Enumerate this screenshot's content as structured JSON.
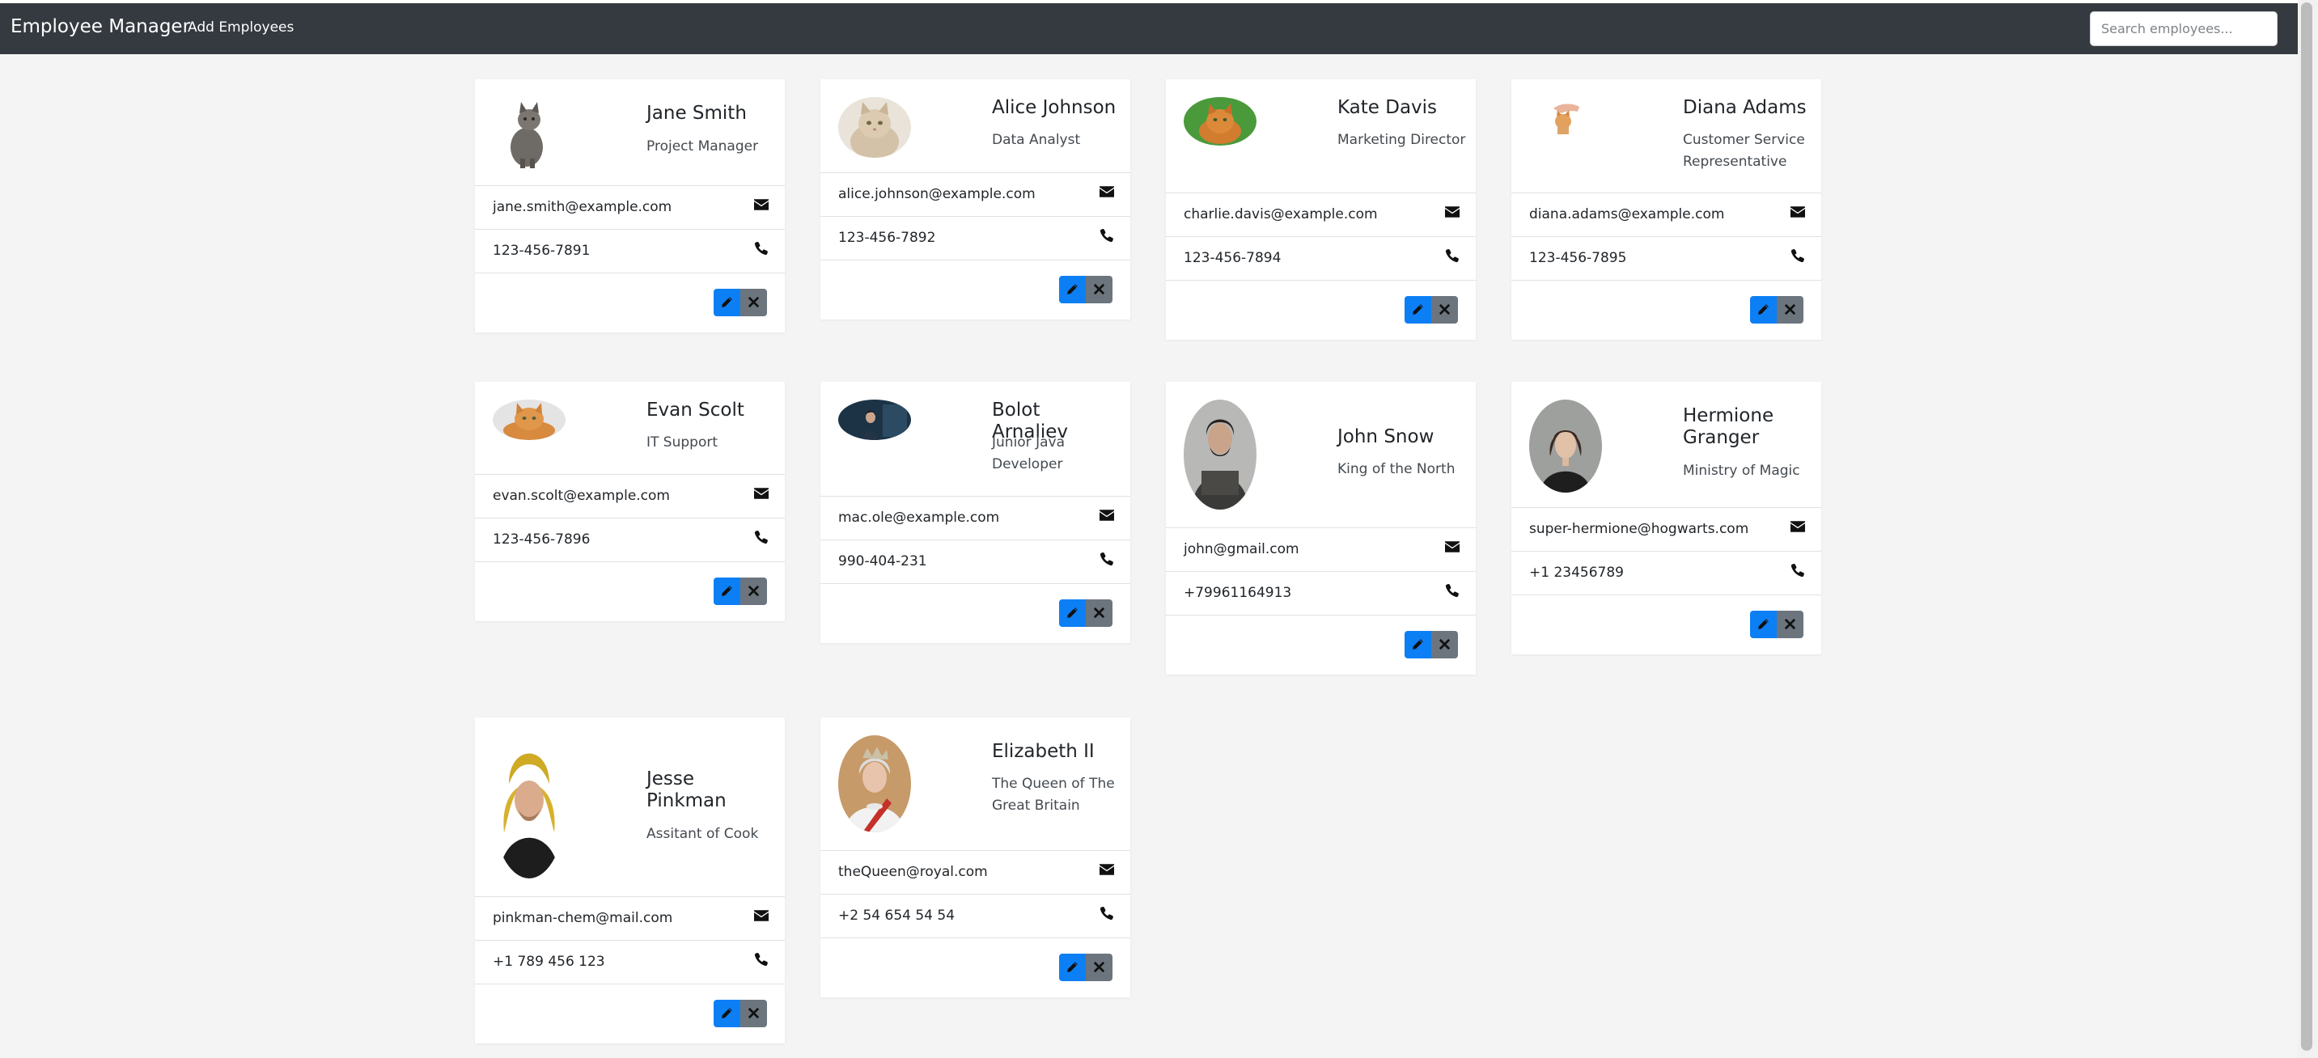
{
  "navbar": {
    "brand": "Employee Manager",
    "add_link": "Add Employees",
    "search_placeholder": "Search employees..."
  },
  "colors": {
    "navbar_bg": "#343a40",
    "edit_button": "#0d7ff5",
    "delete_button": "#6c757d",
    "page_bg": "#f4f4f4"
  },
  "employees": [
    {
      "name": "Jane Smith",
      "position": "Project Manager",
      "email": "jane.smith@example.com",
      "phone": "123-456-7891",
      "avatar": "grey-cat"
    },
    {
      "name": "Alice Johnson",
      "position": "Data Analyst",
      "email": "alice.johnson@example.com",
      "phone": "123-456-7892",
      "avatar": "fluffy-cat"
    },
    {
      "name": "Kate Davis",
      "position": "Marketing Director",
      "email": "charlie.davis@example.com",
      "phone": "123-456-7894",
      "avatar": "orange-cat-grass"
    },
    {
      "name": "Diana Adams",
      "position": "Customer Service Representative",
      "email": "diana.adams@example.com",
      "phone": "123-456-7895",
      "avatar": "hand-with-kitten"
    },
    {
      "name": "Evan Scolt",
      "position": "IT Support",
      "email": "evan.scolt@example.com",
      "phone": "123-456-7896",
      "avatar": "lying-cat"
    },
    {
      "name": "Bolot Arnaliev",
      "position": "Junior Java Developer",
      "email": "mac.ole@example.com",
      "phone": "990-404-231",
      "avatar": "dark-portrait"
    },
    {
      "name": "John Snow",
      "position": "King of the North",
      "email": "john@gmail.com",
      "phone": "+79961164913",
      "avatar": "armored-man"
    },
    {
      "name": "Hermione Granger",
      "position": "Ministry of Magic",
      "email": "super-hermione@hogwarts.com",
      "phone": "+1 23456789",
      "avatar": "young-woman"
    },
    {
      "name": "Jesse Pinkman",
      "position": "Assitant of Cook",
      "email": "pinkman-chem@mail.com",
      "phone": "+1 789 456 123",
      "avatar": "yellow-hood-man"
    },
    {
      "name": "Elizabeth II",
      "position": "The Queen of The Great Britain",
      "email": "theQueen@royal.com",
      "phone": "+2 54 654 54 54",
      "avatar": "queen-portrait"
    }
  ],
  "icons": {
    "email": "envelope-icon",
    "phone": "phone-icon",
    "edit": "pencil-icon",
    "delete": "close-icon"
  }
}
